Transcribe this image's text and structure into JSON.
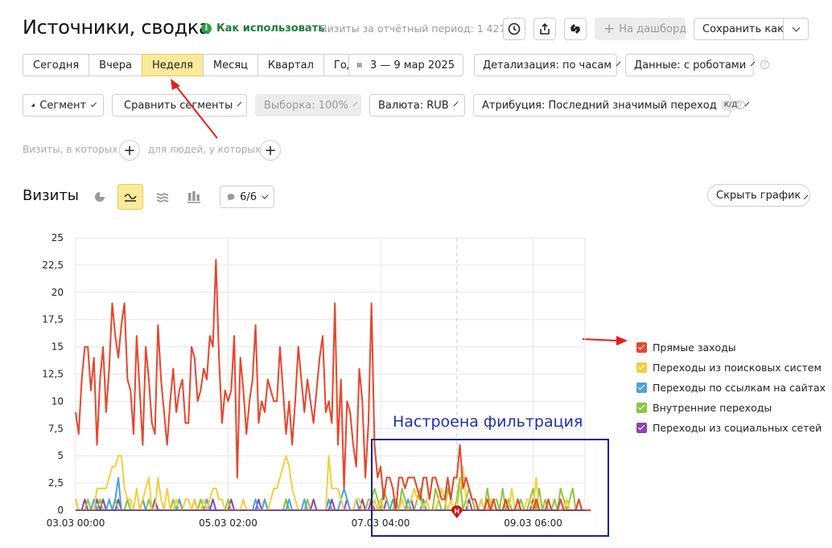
{
  "header": {
    "title": "Источники, сводка",
    "howto": "Как использовать",
    "visits_period": "Визиты за отчётный период: 1 427",
    "to_dashboard": "На дашборд",
    "save_as": "Сохранить как"
  },
  "periods": [
    "Сегодня",
    "Вчера",
    "Неделя",
    "Месяц",
    "Квартал",
    "Год"
  ],
  "active_period": "Неделя",
  "date_range": "3 — 9 мар 2025",
  "detail": "Детализация: по часам",
  "data_robots": "Данные: с роботами",
  "filters": {
    "segment": "Сегмент",
    "compare": "Сравнить сегменты",
    "sample": "Выборка: 100%",
    "currency": "Валюта: RUB",
    "attribution": "Атрибуция: Последний значимый переход",
    "attribution_badge": "К/Д"
  },
  "conditions": {
    "visits_where": "Визиты, в которых",
    "people_where": "для людей, у которых"
  },
  "chart_section": {
    "title": "Визиты",
    "metrics_count": "6/6",
    "hide_chart": "Скрыть график"
  },
  "annotation": {
    "text": "Настроена фильтрация",
    "marker": "Н"
  },
  "chart_data": {
    "type": "line",
    "ylim": [
      0,
      25
    ],
    "yticks": [
      "25",
      "22,5",
      "20",
      "17,5",
      "15",
      "12,5",
      "10",
      "7,5",
      "5",
      "2,5",
      "0"
    ],
    "xtick_labels": [
      "03.03 00:00",
      "05.03 02:00",
      "07.03 04:00",
      "09.03 06:00"
    ],
    "xtick_hours": [
      0,
      50,
      100,
      150
    ],
    "x_range_hours": [
      0,
      167
    ],
    "series": [
      {
        "name": "Прямые заходы",
        "color": "#e8452c",
        "values": [
          9,
          7,
          12,
          15,
          15,
          11,
          14,
          6,
          12,
          15,
          9,
          13,
          19,
          16,
          14,
          17,
          19,
          12,
          11,
          7,
          16,
          11,
          6,
          15,
          12,
          8,
          7,
          17,
          12,
          9,
          6,
          10,
          13,
          9,
          11,
          12,
          8,
          8,
          15,
          14,
          10,
          11,
          13,
          12,
          16,
          15,
          23,
          14,
          8,
          11,
          10,
          11,
          16,
          3,
          14,
          11,
          7,
          10,
          12,
          17,
          8,
          10,
          9,
          12,
          11,
          10,
          10,
          15,
          11,
          7,
          10,
          6,
          10,
          15,
          12,
          9,
          12,
          10,
          8,
          11,
          14,
          16,
          9,
          10,
          8,
          19,
          6,
          12,
          2,
          10,
          9,
          6,
          4,
          13,
          10,
          3,
          8,
          19,
          6,
          3,
          4,
          1,
          3,
          3,
          2,
          0,
          3,
          3,
          2,
          3,
          3,
          3,
          2,
          1,
          3,
          3,
          1,
          3,
          3,
          2,
          1,
          1,
          3,
          1,
          3,
          3,
          6,
          2,
          3,
          2,
          1,
          1,
          0,
          0,
          0,
          1,
          0,
          1,
          0,
          0,
          0,
          1,
          0,
          0,
          0,
          1,
          0,
          0,
          0,
          0,
          0,
          1,
          0,
          0,
          0,
          1,
          0,
          0,
          0,
          1,
          0,
          0,
          0,
          0,
          0,
          1,
          0,
          0,
          0,
          0
        ]
      },
      {
        "name": "Переходы из поисковых систем",
        "color": "#f4cf3c",
        "values": [
          1,
          0,
          0,
          0,
          0,
          0,
          0,
          2,
          2,
          2,
          2,
          3,
          4,
          4,
          5,
          5,
          2,
          1,
          1,
          0,
          2,
          0,
          1,
          2,
          3,
          0,
          0,
          3,
          1,
          0,
          2,
          0,
          0,
          1,
          0,
          0,
          1,
          1,
          0,
          1,
          0,
          0,
          1,
          0,
          1,
          2,
          2,
          1,
          1,
          0,
          0,
          0,
          0,
          0,
          0,
          1,
          0,
          0,
          0,
          0,
          0,
          0,
          0,
          0,
          1,
          2,
          2,
          3,
          4,
          5,
          4,
          2,
          1,
          0,
          0,
          0,
          0,
          0,
          0,
          0,
          0,
          0,
          0,
          5,
          2,
          2,
          2,
          1,
          0,
          0,
          0,
          0,
          1,
          1,
          0,
          0,
          0,
          0,
          1,
          0,
          1,
          0,
          0,
          0,
          0,
          0,
          0,
          1,
          0,
          0,
          1,
          2,
          1,
          1,
          0,
          1,
          0,
          0,
          0,
          1,
          2,
          1,
          0,
          1,
          0,
          0,
          2,
          4,
          1,
          0,
          0,
          0,
          0,
          1,
          0,
          0,
          1,
          0,
          0,
          0,
          0,
          1,
          0,
          2,
          0,
          1,
          0,
          0,
          1,
          1,
          0,
          3,
          0,
          0,
          0,
          1,
          0,
          0,
          0,
          0,
          0,
          1,
          0,
          0,
          0,
          1,
          0,
          0
        ]
      },
      {
        "name": "Переходы по ссылкам на сайтах",
        "color": "#4aa3df",
        "values": [
          0,
          0,
          0,
          0,
          0,
          0,
          1,
          0,
          0,
          0,
          0,
          1,
          0,
          1,
          3,
          0,
          0,
          0,
          0,
          0,
          0,
          0,
          1,
          0,
          0,
          0,
          0,
          0,
          0,
          0,
          0,
          0,
          0,
          0,
          1,
          0,
          0,
          0,
          0,
          0,
          0,
          0,
          0,
          1,
          0,
          0,
          0,
          0,
          0,
          0,
          0,
          0,
          0,
          0,
          0,
          0,
          0,
          0,
          0,
          1,
          0,
          0,
          1,
          0,
          0,
          0,
          0,
          0,
          0,
          0,
          1,
          0,
          0,
          0,
          0,
          1,
          0,
          0,
          0,
          0,
          0,
          0,
          0,
          1,
          0,
          0,
          0,
          1,
          2,
          1,
          0,
          0,
          1,
          0,
          0,
          0,
          0,
          0,
          0,
          0,
          1,
          0,
          0,
          0,
          1,
          0,
          0,
          0,
          0,
          1,
          0,
          0,
          0,
          0,
          1,
          0,
          0,
          0,
          0,
          0,
          0,
          0,
          0,
          0,
          0,
          0,
          0,
          0,
          0,
          0,
          0,
          0,
          0,
          1,
          0,
          0,
          0,
          0,
          0,
          0,
          0,
          0,
          0,
          0,
          0,
          0,
          0,
          0,
          0,
          0,
          0,
          0,
          0,
          0,
          0,
          0,
          0,
          0,
          0,
          1,
          0,
          0,
          0,
          0,
          0,
          0,
          0,
          0
        ]
      },
      {
        "name": "Внутренние переходы",
        "color": "#8cc63f",
        "values": [
          0,
          0,
          0,
          0,
          1,
          0,
          0,
          0,
          1,
          0,
          0,
          0,
          0,
          1,
          0,
          0,
          0,
          1,
          0,
          0,
          0,
          0,
          0,
          0,
          1,
          0,
          0,
          0,
          0,
          0,
          0,
          0,
          1,
          0,
          0,
          0,
          0,
          0,
          0,
          0,
          0,
          1,
          0,
          0,
          0,
          0,
          0,
          0,
          0,
          0,
          1,
          0,
          0,
          0,
          0,
          0,
          0,
          0,
          0,
          0,
          0,
          0,
          1,
          0,
          0,
          0,
          0,
          0,
          0,
          1,
          0,
          0,
          0,
          0,
          0,
          0,
          1,
          0,
          0,
          0,
          0,
          0,
          0,
          1,
          0,
          0,
          0,
          0,
          0,
          0,
          0,
          0,
          1,
          0,
          0,
          0,
          1,
          1,
          2,
          1,
          0,
          2,
          1,
          0,
          0,
          1,
          0,
          2,
          1,
          0,
          0,
          0,
          1,
          2,
          0,
          1,
          0,
          0,
          2,
          1,
          0,
          0,
          2,
          1,
          0,
          1,
          3,
          0,
          1,
          2,
          1,
          0,
          0,
          1,
          0,
          2,
          0,
          1,
          1,
          0,
          2,
          0,
          1,
          0,
          0,
          0,
          1,
          0,
          0,
          1,
          2,
          0,
          2,
          0,
          1,
          0,
          0,
          1,
          0,
          2,
          1,
          0,
          1,
          2,
          0,
          1,
          0,
          0
        ]
      },
      {
        "name": "Переходы из социальных сетей",
        "color": "#8e44ad",
        "values": [
          1,
          0,
          0,
          1,
          0,
          0,
          0,
          1,
          0,
          1,
          0,
          0,
          0,
          0,
          1,
          0,
          0,
          1,
          0,
          0,
          0,
          0,
          1,
          0,
          0,
          0,
          1,
          0,
          0,
          0,
          0,
          0,
          0,
          0,
          1,
          0,
          0,
          0,
          0,
          1,
          0,
          0,
          0,
          0,
          0,
          1,
          0,
          0,
          0,
          0,
          0,
          1,
          0,
          0,
          0,
          0,
          0,
          0,
          0,
          0,
          1,
          0,
          0,
          0,
          0,
          0,
          0,
          0,
          0,
          1,
          0,
          0,
          0,
          0,
          0,
          0,
          0,
          0,
          1,
          0,
          0,
          0,
          0,
          0,
          1,
          0,
          0,
          0,
          0,
          1,
          0,
          0,
          0,
          0,
          1,
          0,
          0,
          1,
          0,
          0,
          0,
          0,
          1,
          0,
          0,
          0,
          0,
          0,
          0,
          0,
          1,
          0,
          0,
          0,
          0,
          0,
          0,
          0,
          0,
          1,
          0,
          0,
          0,
          0,
          0,
          0,
          0,
          0,
          0,
          1,
          0,
          0,
          0,
          0,
          0,
          0,
          1,
          0,
          0,
          0,
          0,
          1,
          0,
          0,
          0,
          0,
          0,
          0,
          0,
          0,
          1,
          0,
          0,
          0,
          0,
          0,
          0,
          0,
          0,
          0,
          0,
          1,
          0,
          0,
          0,
          0,
          0,
          0
        ]
      }
    ]
  }
}
